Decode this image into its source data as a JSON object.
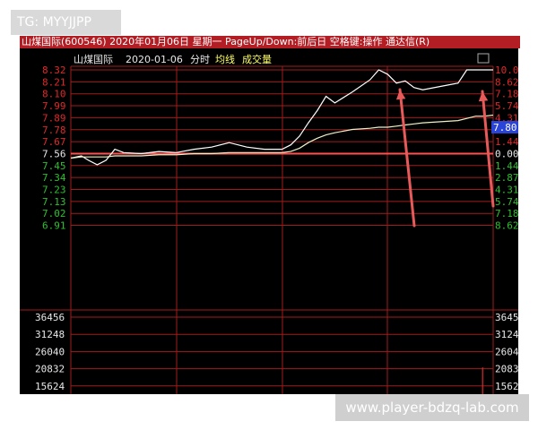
{
  "watermark_top": "TG: MYYJJPP",
  "watermark_bottom": "www.player-bdzq-lab.com",
  "title_bar": "山煤国际(600546) 2020年01月06日 星期一 PageUp/Down:前后日 空格键:操作 通达信(R)",
  "chart_header": {
    "stock": "山煤国际",
    "date": "2020-01-06",
    "mode": "分时",
    "avg": "均线",
    "volume": "成交量"
  },
  "current_price_tag": "7.80",
  "colors": {
    "background": "#000000",
    "grid": "#a01c1c",
    "up": "#e02828",
    "down": "#2ec02e",
    "price_line": "#ffffff",
    "avg_line": "#f0f0c8",
    "arrow": "#e85a5a",
    "tag_bg": "#2a44d8"
  },
  "chart_data": {
    "type": "line",
    "title": "山煤国际 2020-01-06 分时",
    "xlabel": "",
    "ylabel": "",
    "ylim": [
      6.85,
      8.35
    ],
    "prev_close": 7.56,
    "y_ticks_left": [
      "8.32",
      "8.21",
      "8.10",
      "7.99",
      "7.89",
      "7.78",
      "7.67",
      "7.56",
      "7.45",
      "7.34",
      "7.23",
      "7.13",
      "7.02",
      "6.91"
    ],
    "y_ticks_right": [
      "10.0",
      "8.62",
      "7.18",
      "5.74",
      "4.31",
      "2.87",
      "1.44",
      "0.00",
      "1.44",
      "2.87",
      "4.31",
      "5.74",
      "7.18",
      "8.62"
    ],
    "volume_ticks_left": [
      "36456",
      "31248",
      "26040",
      "20832",
      "15624"
    ],
    "volume_ticks_right": [
      "3645",
      "3124",
      "2604",
      "2083",
      "1562"
    ],
    "x": [
      0,
      6,
      10,
      15,
      20,
      25,
      30,
      40,
      50,
      60,
      70,
      80,
      90,
      100,
      110,
      120,
      125,
      130,
      135,
      140,
      145,
      150,
      160,
      170,
      175,
      180,
      185,
      190,
      195,
      200,
      210,
      220,
      225,
      230,
      235,
      240
    ],
    "series": [
      {
        "values": [
          7.52,
          7.54,
          7.5,
          7.46,
          7.5,
          7.6,
          7.57,
          7.56,
          7.58,
          7.57,
          7.6,
          7.62,
          7.66,
          7.62,
          7.6,
          7.6,
          7.64,
          7.72,
          7.84,
          7.95,
          8.08,
          8.02,
          8.12,
          8.23,
          8.32,
          8.28,
          8.2,
          8.22,
          8.16,
          8.14,
          8.17,
          8.2,
          8.32,
          8.32,
          8.32,
          8.32
        ]
      },
      {
        "values": [
          7.52,
          7.53,
          7.53,
          7.53,
          7.53,
          7.54,
          7.54,
          7.54,
          7.55,
          7.55,
          7.56,
          7.56,
          7.57,
          7.57,
          7.57,
          7.57,
          7.58,
          7.61,
          7.66,
          7.7,
          7.73,
          7.75,
          7.78,
          7.79,
          7.8,
          7.8,
          7.81,
          7.82,
          7.83,
          7.84,
          7.85,
          7.86,
          7.88,
          7.9,
          7.9,
          7.91
        ]
      }
    ],
    "volume": [
      {
        "x": 234,
        "value": 15624
      }
    ]
  }
}
